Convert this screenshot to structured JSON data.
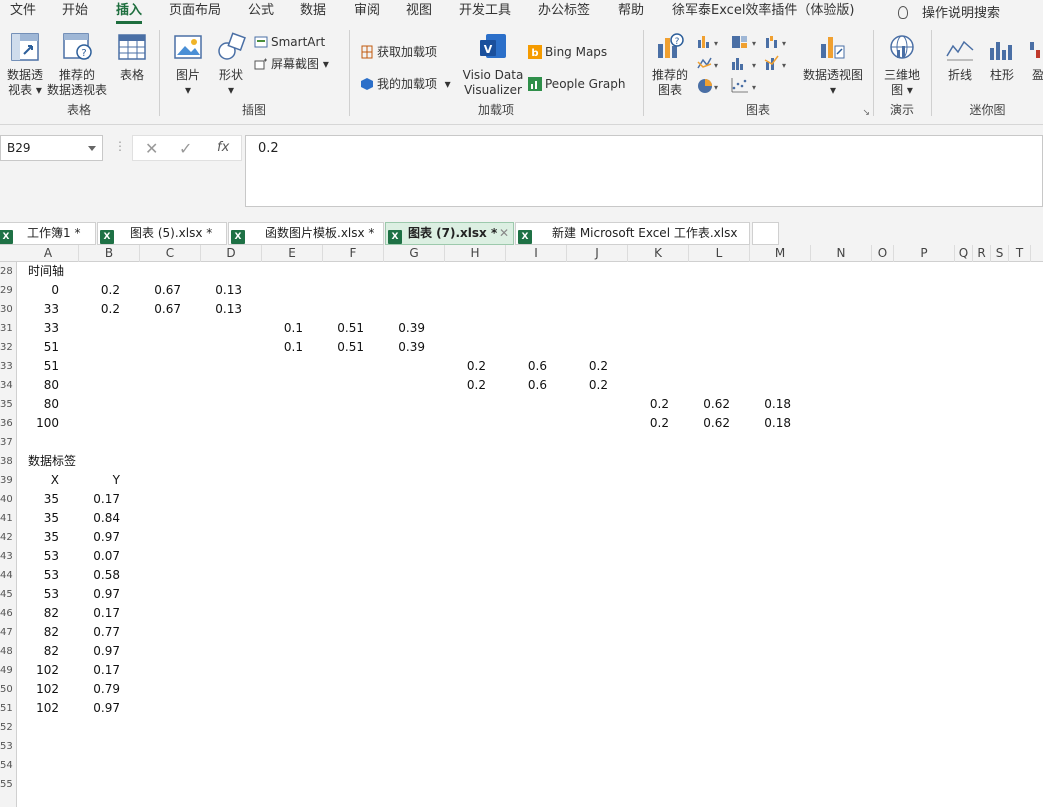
{
  "menu": {
    "items": [
      "文件",
      "开始",
      "插入",
      "页面布局",
      "公式",
      "数据",
      "审阅",
      "视图",
      "开发工具",
      "办公标签",
      "帮助",
      "徐军泰Excel效率插件（体验版)"
    ],
    "active": "插入",
    "tell_me": "操作说明搜索"
  },
  "ribbon": {
    "tables": {
      "title": "表格",
      "pivot": [
        "数据透",
        "视表"
      ],
      "recommended_pivot": [
        "推荐的",
        "数据透视表"
      ],
      "table": "表格"
    },
    "illustrations": {
      "title": "插图",
      "picture": "图片",
      "shapes": "形状",
      "smartart": "SmartArt",
      "screenshot": "屏幕截图"
    },
    "addins": {
      "title": "加载项",
      "get": "获取加载项",
      "my": "我的加载项",
      "visio": [
        "Visio Data",
        "Visualizer"
      ],
      "bing": "Bing Maps",
      "people": "People Graph"
    },
    "charts": {
      "title": "图表",
      "recommended": [
        "推荐的",
        "图表"
      ],
      "pivotchart": "数据透视图"
    },
    "tours": {
      "title": "演示",
      "map3d": [
        "三维地",
        "图"
      ]
    },
    "sparklines": {
      "title": "迷你图",
      "line": "折线",
      "column": "柱形",
      "winloss": "盈"
    }
  },
  "formula_bar": {
    "name_box": "B29",
    "fx": "fx",
    "value": "0.2"
  },
  "tabs": [
    {
      "label": "工作簿1 *",
      "active": false
    },
    {
      "label": "图表 (5).xlsx *",
      "active": false
    },
    {
      "label": "函数图片模板.xlsx *",
      "active": false
    },
    {
      "label": "图表 (7).xlsx *",
      "active": true
    },
    {
      "label": "新建 Microsoft Excel 工作表.xlsx",
      "active": false
    }
  ],
  "columns": [
    "A",
    "B",
    "C",
    "D",
    "E",
    "F",
    "G",
    "H",
    "I",
    "J",
    "K",
    "L",
    "M",
    "N",
    "O",
    "P",
    "Q",
    "R",
    "S",
    "T"
  ],
  "rows": [
    "28",
    "29",
    "30",
    "31",
    "32",
    "33",
    "34",
    "35",
    "36",
    "37",
    "38",
    "39",
    "40",
    "41",
    "42",
    "43",
    "44",
    "45",
    "46",
    "47",
    "48",
    "49",
    "50",
    "51",
    "52",
    "53",
    "54",
    "55"
  ],
  "cells": [
    {
      "row": 0,
      "col": "A",
      "v": "时间轴",
      "align": "l"
    },
    {
      "row": 1,
      "col": "A",
      "v": "0"
    },
    {
      "row": 1,
      "col": "B",
      "v": "0.2"
    },
    {
      "row": 1,
      "col": "C",
      "v": "0.67"
    },
    {
      "row": 1,
      "col": "D",
      "v": "0.13"
    },
    {
      "row": 2,
      "col": "A",
      "v": "33"
    },
    {
      "row": 2,
      "col": "B",
      "v": "0.2"
    },
    {
      "row": 2,
      "col": "C",
      "v": "0.67"
    },
    {
      "row": 2,
      "col": "D",
      "v": "0.13"
    },
    {
      "row": 3,
      "col": "A",
      "v": "33"
    },
    {
      "row": 3,
      "col": "E",
      "v": "0.1"
    },
    {
      "row": 3,
      "col": "F",
      "v": "0.51"
    },
    {
      "row": 3,
      "col": "G",
      "v": "0.39"
    },
    {
      "row": 4,
      "col": "A",
      "v": "51"
    },
    {
      "row": 4,
      "col": "E",
      "v": "0.1"
    },
    {
      "row": 4,
      "col": "F",
      "v": "0.51"
    },
    {
      "row": 4,
      "col": "G",
      "v": "0.39"
    },
    {
      "row": 5,
      "col": "A",
      "v": "51"
    },
    {
      "row": 5,
      "col": "H",
      "v": "0.2"
    },
    {
      "row": 5,
      "col": "I",
      "v": "0.6"
    },
    {
      "row": 5,
      "col": "J",
      "v": "0.2"
    },
    {
      "row": 6,
      "col": "A",
      "v": "80"
    },
    {
      "row": 6,
      "col": "H",
      "v": "0.2"
    },
    {
      "row": 6,
      "col": "I",
      "v": "0.6"
    },
    {
      "row": 6,
      "col": "J",
      "v": "0.2"
    },
    {
      "row": 7,
      "col": "A",
      "v": "80"
    },
    {
      "row": 7,
      "col": "K",
      "v": "0.2"
    },
    {
      "row": 7,
      "col": "L",
      "v": "0.62"
    },
    {
      "row": 7,
      "col": "M",
      "v": "0.18"
    },
    {
      "row": 8,
      "col": "A",
      "v": "100"
    },
    {
      "row": 8,
      "col": "K",
      "v": "0.2"
    },
    {
      "row": 8,
      "col": "L",
      "v": "0.62"
    },
    {
      "row": 8,
      "col": "M",
      "v": "0.18"
    },
    {
      "row": 10,
      "col": "A",
      "v": "数据标签",
      "align": "l"
    },
    {
      "row": 11,
      "col": "A",
      "v": "X"
    },
    {
      "row": 11,
      "col": "B",
      "v": "Y"
    },
    {
      "row": 12,
      "col": "A",
      "v": "35"
    },
    {
      "row": 12,
      "col": "B",
      "v": "0.17"
    },
    {
      "row": 13,
      "col": "A",
      "v": "35"
    },
    {
      "row": 13,
      "col": "B",
      "v": "0.84"
    },
    {
      "row": 14,
      "col": "A",
      "v": "35"
    },
    {
      "row": 14,
      "col": "B",
      "v": "0.97"
    },
    {
      "row": 15,
      "col": "A",
      "v": "53"
    },
    {
      "row": 15,
      "col": "B",
      "v": "0.07"
    },
    {
      "row": 16,
      "col": "A",
      "v": "53"
    },
    {
      "row": 16,
      "col": "B",
      "v": "0.58"
    },
    {
      "row": 17,
      "col": "A",
      "v": "53"
    },
    {
      "row": 17,
      "col": "B",
      "v": "0.97"
    },
    {
      "row": 18,
      "col": "A",
      "v": "82"
    },
    {
      "row": 18,
      "col": "B",
      "v": "0.17"
    },
    {
      "row": 19,
      "col": "A",
      "v": "82"
    },
    {
      "row": 19,
      "col": "B",
      "v": "0.77"
    },
    {
      "row": 20,
      "col": "A",
      "v": "82"
    },
    {
      "row": 20,
      "col": "B",
      "v": "0.97"
    },
    {
      "row": 21,
      "col": "A",
      "v": "102"
    },
    {
      "row": 21,
      "col": "B",
      "v": "0.17"
    },
    {
      "row": 22,
      "col": "A",
      "v": "102"
    },
    {
      "row": 22,
      "col": "B",
      "v": "0.79"
    },
    {
      "row": 23,
      "col": "A",
      "v": "102"
    },
    {
      "row": 23,
      "col": "B",
      "v": "0.97"
    }
  ],
  "colors": {
    "accent": "#1e7145",
    "ribbon_bg": "#f3f3f3",
    "active_tab": "#dcefe2"
  }
}
